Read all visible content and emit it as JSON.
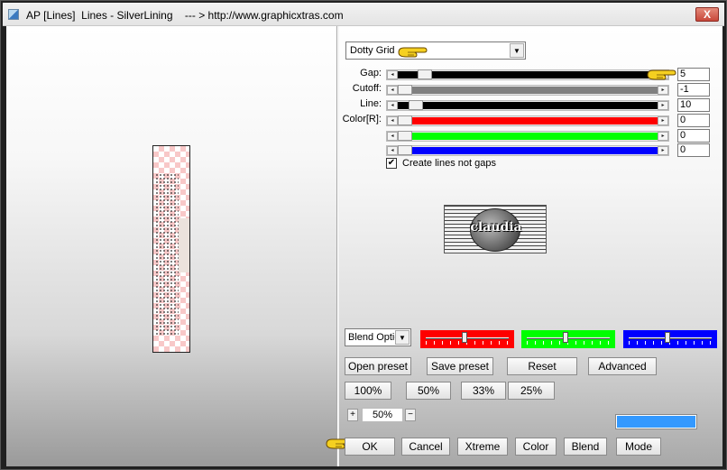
{
  "window": {
    "title": "AP [Lines]  Lines - SilverLining    --- > http://www.graphicxtras.com",
    "close_label": "X"
  },
  "preset": {
    "selected": "Dotty Grid",
    "arrow": "▼"
  },
  "params": [
    {
      "label": "Gap:",
      "value": "5",
      "fill_color": "#000000",
      "position": 0.08,
      "fill_from_thumb": true
    },
    {
      "label": "Cutoff:",
      "value": "-1",
      "fill_color": "#808080",
      "position": 0.0,
      "fill_from_thumb": true
    },
    {
      "label": "Line:",
      "value": "10",
      "fill_color": "#000000",
      "position": 0.03,
      "fill_from_thumb": true,
      "left_block": true
    },
    {
      "label": "Color[R]:",
      "value": "0",
      "fill_color": "#ff0000",
      "position": 0.0,
      "fill_from_thumb": true
    },
    {
      "label": "",
      "value": "0",
      "fill_color": "#00ff00",
      "position": 0.0,
      "fill_from_thumb": true
    },
    {
      "label": "",
      "value": "0",
      "fill_color": "#0000ff",
      "position": 0.0,
      "fill_from_thumb": true
    }
  ],
  "slider_arrows": {
    "left": "◂",
    "right": "▸"
  },
  "checkbox": {
    "label": "Create lines not gaps",
    "checked": true,
    "mark": "✔"
  },
  "logo_text": "claudia",
  "blend": {
    "selected": "Blend Optio",
    "arrow": "▼"
  },
  "color_sliders": [
    {
      "name": "red",
      "color": "#ff0000",
      "value": 0.5
    },
    {
      "name": "green",
      "color": "#00ff00",
      "value": 0.5
    },
    {
      "name": "blue",
      "color": "#0000ff",
      "value": 0.5
    }
  ],
  "buttons_row1": [
    "Open preset",
    "Save preset",
    "Reset",
    "Advanced"
  ],
  "buttons_zoom": [
    "100%",
    "50%",
    "33%",
    "25%"
  ],
  "zoom_stepper": {
    "plus": "+",
    "value": "50%",
    "minus": "−"
  },
  "swatch_color": "#3399ff",
  "buttons_bottom": [
    "OK",
    "Cancel",
    "Xtreme",
    "Color",
    "Blend",
    "Mode"
  ]
}
